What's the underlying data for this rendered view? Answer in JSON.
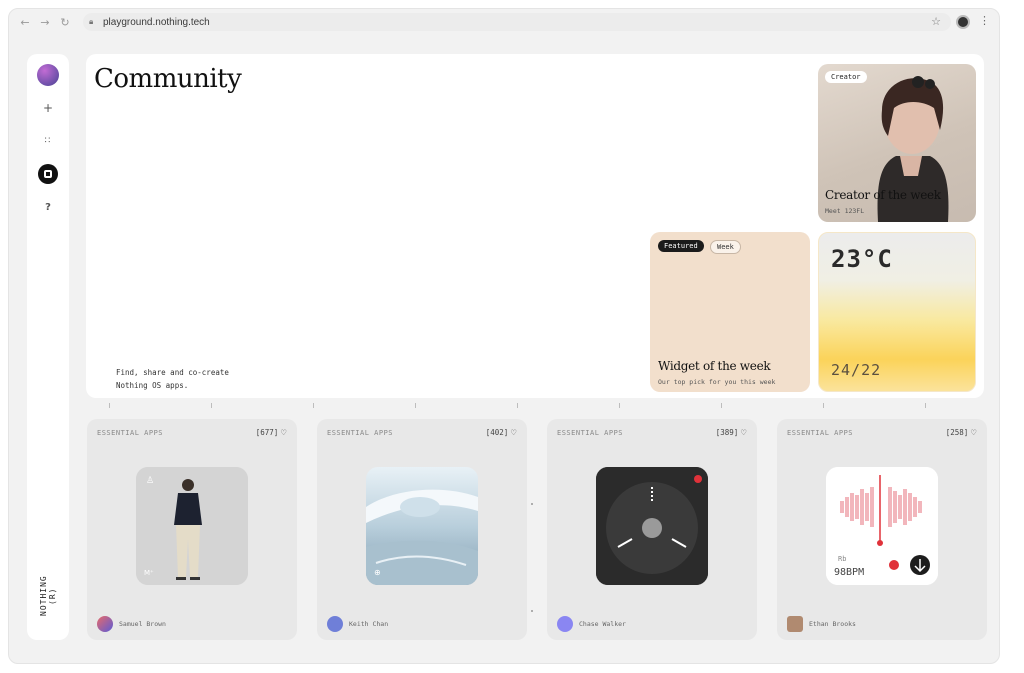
{
  "browser": {
    "url": "playground.nothing.tech",
    "back_icon": "arrow-left-icon",
    "forward_icon": "arrow-right-icon",
    "reload_icon": "reload-icon"
  },
  "sidebar": {
    "brand": "NOTHING (R)",
    "items": [
      {
        "name": "add",
        "glyph": "+"
      },
      {
        "name": "grid",
        "glyph": "⠶"
      },
      {
        "name": "home",
        "glyph": ""
      },
      {
        "name": "help",
        "glyph": "?"
      }
    ]
  },
  "hero": {
    "title": "Community",
    "tagline_line1": "Find, share and co-create",
    "tagline_line2": "Nothing OS apps.",
    "creator_card": {
      "chip": "Creator",
      "title": "Creator of the week",
      "subtitle": "Meet 123FL"
    },
    "widget_card": {
      "chip_featured": "Featured",
      "chip_week": "Week",
      "title": "Widget of the week",
      "subtitle": "Our top pick for you this week"
    },
    "weather_card": {
      "temp": "23°C",
      "range": "24/22"
    }
  },
  "apps": [
    {
      "category": "ESSENTIAL APPS",
      "count": "[677]",
      "author": "Samuel Brown",
      "avatar_color": "#7b5bb8"
    },
    {
      "category": "ESSENTIAL APPS",
      "count": "[402]",
      "author": "Keith Chan",
      "avatar_color": "#6f7fd8"
    },
    {
      "category": "ESSENTIAL APPS",
      "count": "[389]",
      "author": "Chase Walker",
      "avatar_color": "#8a86f2"
    },
    {
      "category": "ESSENTIAL APPS",
      "count": "[258]",
      "author": "Ethan Brooks",
      "avatar_color": "#b08a70"
    }
  ],
  "recorder": {
    "label": "Rb",
    "bpm": "98BPM"
  },
  "colors": {
    "accent": "#111111",
    "widget_bg": "#f2dfcc",
    "weather_warm": "#fbd35a",
    "record_red": "#e0323a"
  }
}
